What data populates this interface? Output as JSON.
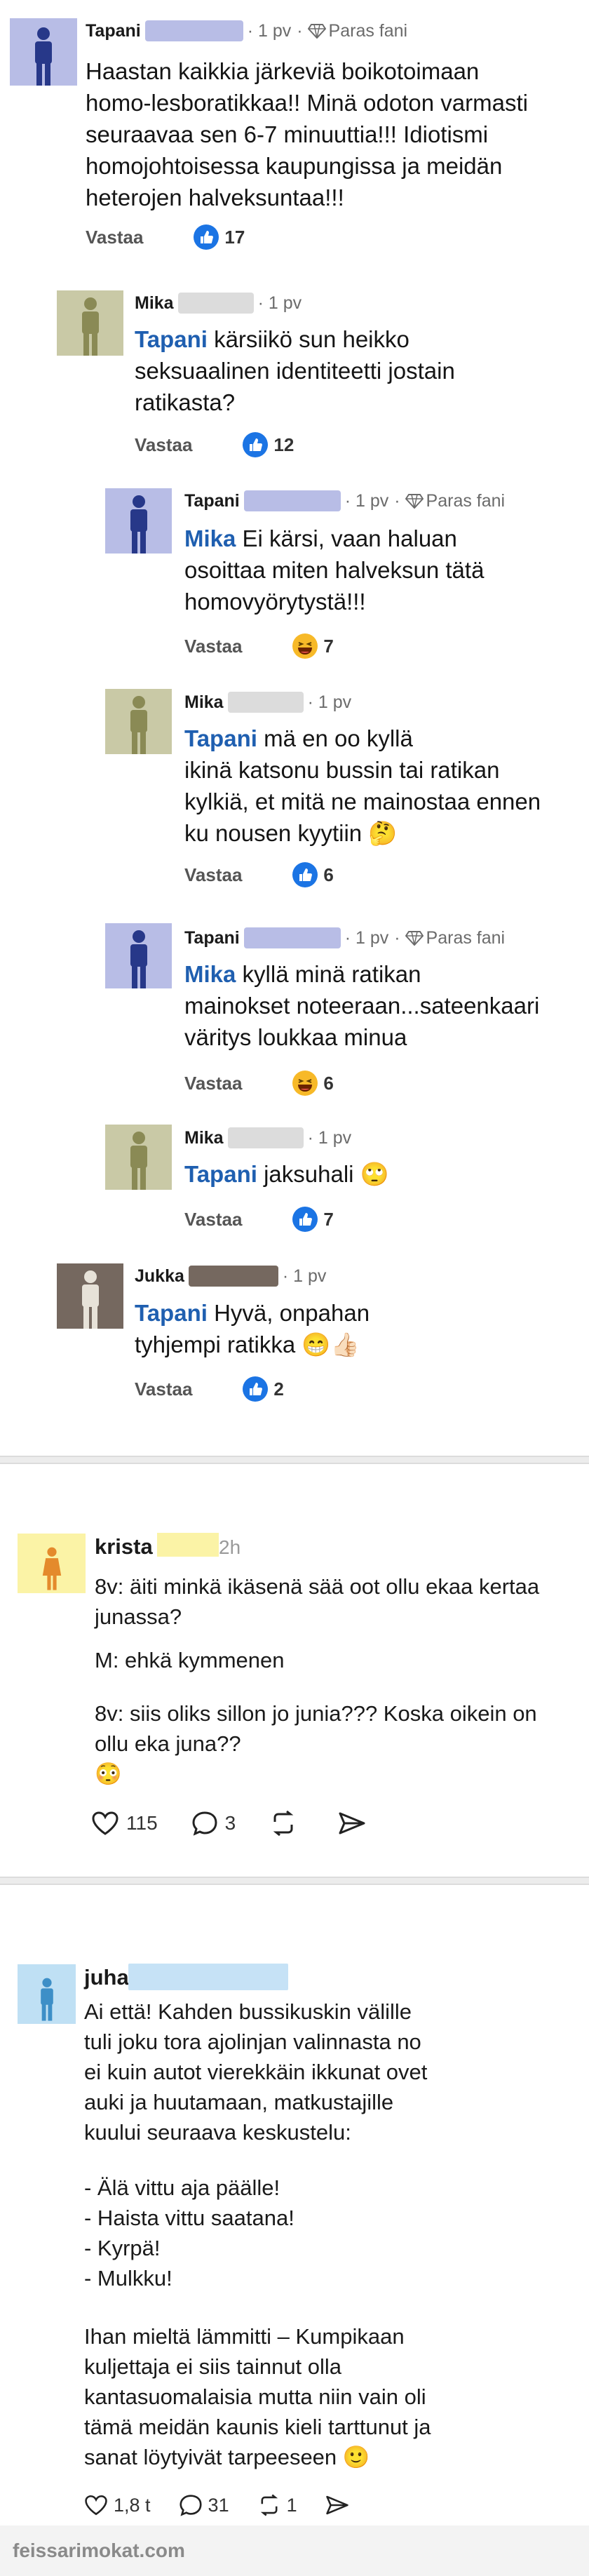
{
  "thread": {
    "comments": [
      {
        "name": "Tapani",
        "time": "1 pv",
        "badge": "Paras fani",
        "lines": [
          "Haastan kaikkia järkeviä boikotoimaan",
          "homo-lesboratikkaa!! Minä odoton varmasti",
          "seuraavaa sen 6-7 minuuttia!!! Idiotismi",
          "homojohtoisessa kaupungissa ja meidän",
          "heterojen halveksuntaa!!!"
        ],
        "reply": "Vastaa",
        "reaction_type": "like",
        "count": "17"
      },
      {
        "name": "Mika",
        "time": "1 pv",
        "mention": "Tapani",
        "lines": [
          "kärsiikö sun heikko",
          "seksuaalinen identiteetti jostain",
          "ratikasta?"
        ],
        "reply": "Vastaa",
        "reaction_type": "like",
        "count": "12"
      },
      {
        "name": "Tapani",
        "time": "1 pv",
        "badge": "Paras fani",
        "mention": "Mika",
        "lines": [
          "Ei kärsi, vaan haluan",
          "osoittaa miten halveksun tätä",
          "homovyörytystä!!!"
        ],
        "reply": "Vastaa",
        "reaction_type": "haha",
        "count": "7"
      },
      {
        "name": "Mika",
        "time": "1 pv",
        "mention": "Tapani",
        "lines": [
          "mä en oo kyllä",
          "ikinä katsonu bussin tai ratikan",
          "kylkiä, et mitä ne mainostaa ennen",
          "ku nousen kyytiin 🤔"
        ],
        "reply": "Vastaa",
        "reaction_type": "like",
        "count": "6"
      },
      {
        "name": "Tapani",
        "time": "1 pv",
        "badge": "Paras fani",
        "mention": "Mika",
        "lines": [
          "kyllä minä ratikan",
          "mainokset noteeraan...sateenkaari",
          "väritys loukkaa minua"
        ],
        "reply": "Vastaa",
        "reaction_type": "haha",
        "count": "6"
      },
      {
        "name": "Mika",
        "time": "1 pv",
        "mention": "Tapani",
        "lines": [
          "jaksuhali 🙄"
        ],
        "reply": "Vastaa",
        "reaction_type": "like",
        "count": "7"
      },
      {
        "name": "Jukka",
        "time": "1 pv",
        "mention": "Tapani",
        "lines": [
          "Hyvä, onpahan",
          "tyhjempi ratikka 😁👍🏻"
        ],
        "reply": "Vastaa",
        "reaction_type": "like",
        "count": "2"
      }
    ]
  },
  "post2": {
    "name": "krista",
    "time": "2h",
    "paragraphs": [
      [
        "8v: äiti minkä ikäsenä sää oot ollu ekaa kertaa",
        "junassa?"
      ],
      [
        "M: ehkä kymmenen"
      ],
      [
        "8v: siis oliks sillon jo junia??? Koska oikein on",
        "ollu eka juna??",
        "😳"
      ]
    ],
    "likes": "115",
    "comments": "3"
  },
  "post3": {
    "name": "juha",
    "paragraphs": [
      [
        "Ai että! Kahden bussikuskin välille",
        "tuli joku tora ajolinjan valinnasta no",
        "ei kuin autot vierekkäin ikkunat ovet",
        "auki ja huutamaan, matkustajille",
        "kuului seuraava keskustelu:"
      ],
      [
        "- Älä vittu aja päälle!",
        "- Haista vittu saatana!",
        "- Kyrpä!",
        "- Mulkku!"
      ],
      [
        "Ihan mieltä lämmitti – Kumpikaan",
        "kuljettaja ei siis tainnut olla",
        "kantasuomalaisia mutta niin vain oli",
        "tämä meidän kaunis kieli tarttunut ja",
        "sanat löytyivät tarpeeseen 🙂"
      ]
    ],
    "likes": "1,8 t",
    "comments": "31",
    "reposts": "1"
  },
  "footer": {
    "watermark": "feissarimokat.com"
  },
  "colors": {
    "mention": "#1f5fb0",
    "like": "#1b74e4",
    "haha": "#f7b928"
  }
}
